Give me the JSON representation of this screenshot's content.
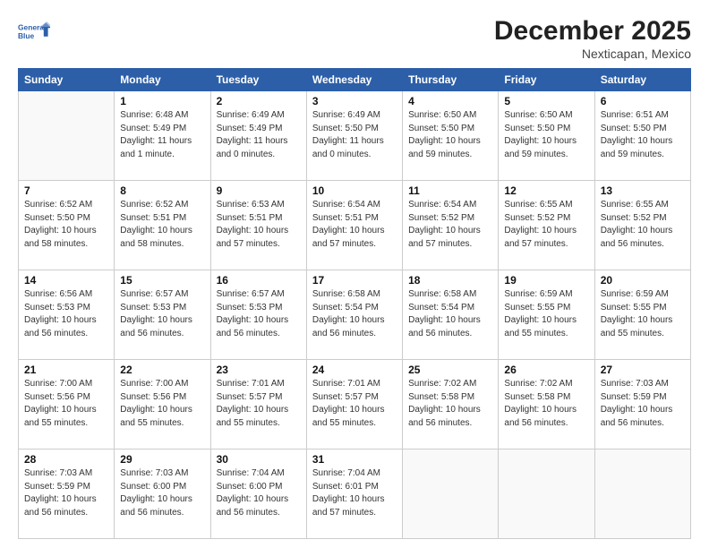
{
  "header": {
    "logo_line1": "General",
    "logo_line2": "Blue",
    "title": "December 2025",
    "subtitle": "Nexticapan, Mexico"
  },
  "days_of_week": [
    "Sunday",
    "Monday",
    "Tuesday",
    "Wednesday",
    "Thursday",
    "Friday",
    "Saturday"
  ],
  "weeks": [
    [
      {
        "day": "",
        "info": ""
      },
      {
        "day": "1",
        "info": "Sunrise: 6:48 AM\nSunset: 5:49 PM\nDaylight: 11 hours\nand 1 minute."
      },
      {
        "day": "2",
        "info": "Sunrise: 6:49 AM\nSunset: 5:49 PM\nDaylight: 11 hours\nand 0 minutes."
      },
      {
        "day": "3",
        "info": "Sunrise: 6:49 AM\nSunset: 5:50 PM\nDaylight: 11 hours\nand 0 minutes."
      },
      {
        "day": "4",
        "info": "Sunrise: 6:50 AM\nSunset: 5:50 PM\nDaylight: 10 hours\nand 59 minutes."
      },
      {
        "day": "5",
        "info": "Sunrise: 6:50 AM\nSunset: 5:50 PM\nDaylight: 10 hours\nand 59 minutes."
      },
      {
        "day": "6",
        "info": "Sunrise: 6:51 AM\nSunset: 5:50 PM\nDaylight: 10 hours\nand 59 minutes."
      }
    ],
    [
      {
        "day": "7",
        "info": "Sunrise: 6:52 AM\nSunset: 5:50 PM\nDaylight: 10 hours\nand 58 minutes."
      },
      {
        "day": "8",
        "info": "Sunrise: 6:52 AM\nSunset: 5:51 PM\nDaylight: 10 hours\nand 58 minutes."
      },
      {
        "day": "9",
        "info": "Sunrise: 6:53 AM\nSunset: 5:51 PM\nDaylight: 10 hours\nand 57 minutes."
      },
      {
        "day": "10",
        "info": "Sunrise: 6:54 AM\nSunset: 5:51 PM\nDaylight: 10 hours\nand 57 minutes."
      },
      {
        "day": "11",
        "info": "Sunrise: 6:54 AM\nSunset: 5:52 PM\nDaylight: 10 hours\nand 57 minutes."
      },
      {
        "day": "12",
        "info": "Sunrise: 6:55 AM\nSunset: 5:52 PM\nDaylight: 10 hours\nand 57 minutes."
      },
      {
        "day": "13",
        "info": "Sunrise: 6:55 AM\nSunset: 5:52 PM\nDaylight: 10 hours\nand 56 minutes."
      }
    ],
    [
      {
        "day": "14",
        "info": "Sunrise: 6:56 AM\nSunset: 5:53 PM\nDaylight: 10 hours\nand 56 minutes."
      },
      {
        "day": "15",
        "info": "Sunrise: 6:57 AM\nSunset: 5:53 PM\nDaylight: 10 hours\nand 56 minutes."
      },
      {
        "day": "16",
        "info": "Sunrise: 6:57 AM\nSunset: 5:53 PM\nDaylight: 10 hours\nand 56 minutes."
      },
      {
        "day": "17",
        "info": "Sunrise: 6:58 AM\nSunset: 5:54 PM\nDaylight: 10 hours\nand 56 minutes."
      },
      {
        "day": "18",
        "info": "Sunrise: 6:58 AM\nSunset: 5:54 PM\nDaylight: 10 hours\nand 56 minutes."
      },
      {
        "day": "19",
        "info": "Sunrise: 6:59 AM\nSunset: 5:55 PM\nDaylight: 10 hours\nand 55 minutes."
      },
      {
        "day": "20",
        "info": "Sunrise: 6:59 AM\nSunset: 5:55 PM\nDaylight: 10 hours\nand 55 minutes."
      }
    ],
    [
      {
        "day": "21",
        "info": "Sunrise: 7:00 AM\nSunset: 5:56 PM\nDaylight: 10 hours\nand 55 minutes."
      },
      {
        "day": "22",
        "info": "Sunrise: 7:00 AM\nSunset: 5:56 PM\nDaylight: 10 hours\nand 55 minutes."
      },
      {
        "day": "23",
        "info": "Sunrise: 7:01 AM\nSunset: 5:57 PM\nDaylight: 10 hours\nand 55 minutes."
      },
      {
        "day": "24",
        "info": "Sunrise: 7:01 AM\nSunset: 5:57 PM\nDaylight: 10 hours\nand 55 minutes."
      },
      {
        "day": "25",
        "info": "Sunrise: 7:02 AM\nSunset: 5:58 PM\nDaylight: 10 hours\nand 56 minutes."
      },
      {
        "day": "26",
        "info": "Sunrise: 7:02 AM\nSunset: 5:58 PM\nDaylight: 10 hours\nand 56 minutes."
      },
      {
        "day": "27",
        "info": "Sunrise: 7:03 AM\nSunset: 5:59 PM\nDaylight: 10 hours\nand 56 minutes."
      }
    ],
    [
      {
        "day": "28",
        "info": "Sunrise: 7:03 AM\nSunset: 5:59 PM\nDaylight: 10 hours\nand 56 minutes."
      },
      {
        "day": "29",
        "info": "Sunrise: 7:03 AM\nSunset: 6:00 PM\nDaylight: 10 hours\nand 56 minutes."
      },
      {
        "day": "30",
        "info": "Sunrise: 7:04 AM\nSunset: 6:00 PM\nDaylight: 10 hours\nand 56 minutes."
      },
      {
        "day": "31",
        "info": "Sunrise: 7:04 AM\nSunset: 6:01 PM\nDaylight: 10 hours\nand 57 minutes."
      },
      {
        "day": "",
        "info": ""
      },
      {
        "day": "",
        "info": ""
      },
      {
        "day": "",
        "info": ""
      }
    ]
  ]
}
